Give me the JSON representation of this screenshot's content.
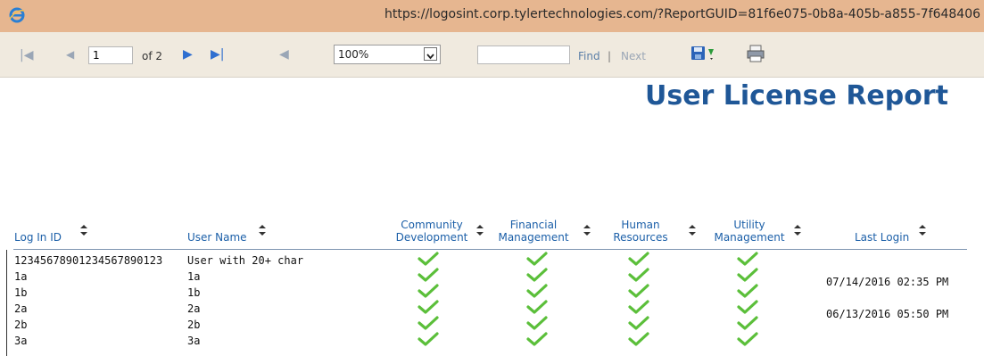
{
  "browser": {
    "url": "https://logosint.corp.tylertechnologies.com/?ReportGUID=81f6e075-0b8a-405b-a855-7f648406"
  },
  "toolbar": {
    "current_page": "1",
    "of_pages": "of 2",
    "zoom": "100%",
    "find_value": "",
    "find_label": "Find",
    "separator": "|",
    "next_label": "Next"
  },
  "report": {
    "title": "User License Report",
    "columns": {
      "login_id": "Log In ID",
      "user_name": "User Name",
      "community_1": "Community",
      "community_2": "Development",
      "financial_1": "Financial",
      "financial_2": "Management",
      "human_1": "Human",
      "human_2": "Resources",
      "utility_1": "Utility",
      "utility_2": "Management",
      "last_login": "Last Login"
    },
    "rows": [
      {
        "login_id": "12345678901234567890123",
        "user_name": "User with 20+ char",
        "last_login": ""
      },
      {
        "login_id": "1a",
        "user_name": "1a",
        "last_login": "07/14/2016  02:35 PM"
      },
      {
        "login_id": "1b",
        "user_name": "1b",
        "last_login": ""
      },
      {
        "login_id": "2a",
        "user_name": "2a",
        "last_login": "06/13/2016  05:50 PM"
      },
      {
        "login_id": "2b",
        "user_name": "2b",
        "last_login": ""
      },
      {
        "login_id": "3a",
        "user_name": "3a",
        "last_login": ""
      }
    ]
  },
  "colors": {
    "accent": "#1f5797",
    "check": "#5bbf3a"
  },
  "icons": [
    "ie-icon",
    "first-page-icon",
    "prev-page-icon",
    "next-page-icon",
    "last-page-icon",
    "back-icon",
    "save-icon",
    "print-icon",
    "sort-icon",
    "checkmark-icon"
  ]
}
